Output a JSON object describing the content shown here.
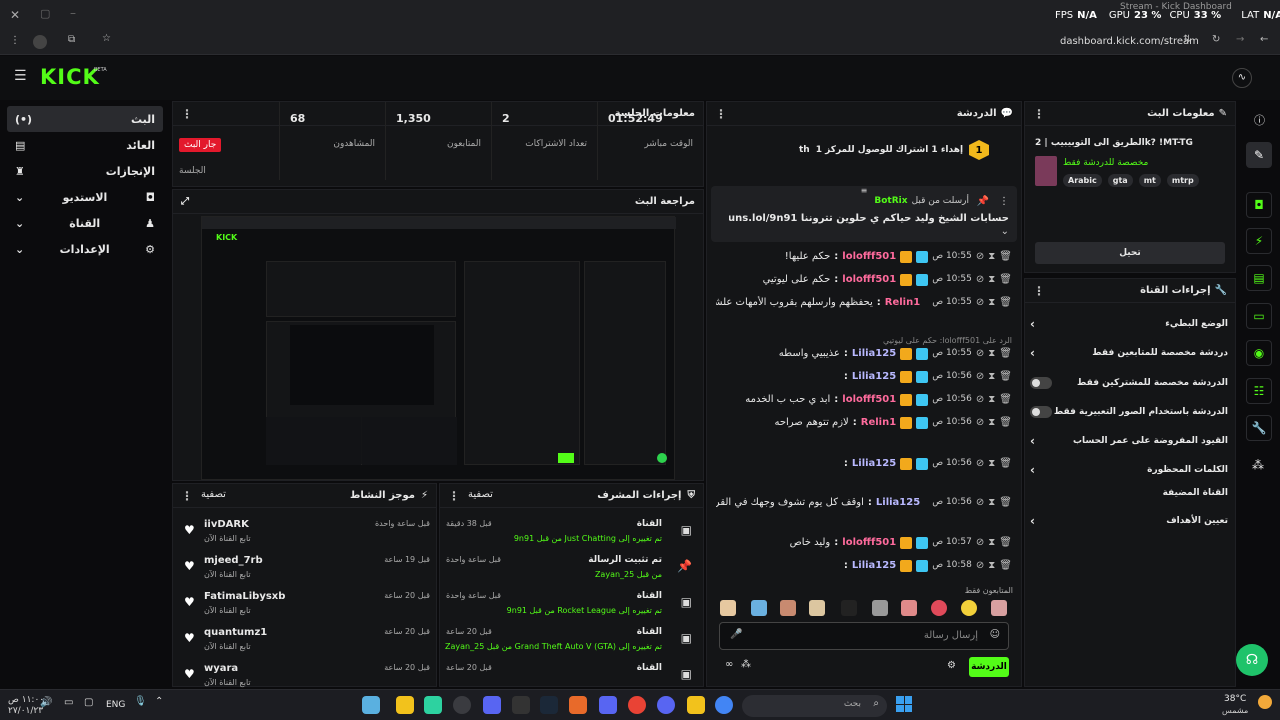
{
  "window": {
    "overlay_fps_label": "FPS",
    "overlay_fps": "N/A",
    "overlay_gpu_label": "GPU",
    "overlay_gpu": "23 %",
    "overlay_cpu_label": "CPU",
    "overlay_cpu": "33 %",
    "overlay_lat_label": "LAT",
    "overlay_lat": "N/A",
    "tab_title": "Stream - Kick Dashboard"
  },
  "browser": {
    "url": "dashboard.kick.com/stream"
  },
  "brand": {
    "logo": "KICK",
    "beta": "BETA",
    "accent": "#53fc18"
  },
  "sidebar": {
    "items": [
      {
        "label": "البث",
        "icon": "broadcast-icon"
      },
      {
        "label": "العائد",
        "icon": "wallet-icon"
      },
      {
        "label": "الإنجازات",
        "icon": "trophy-icon"
      },
      {
        "label": "الاستديو",
        "icon": "studio-icon"
      },
      {
        "label": "القناة",
        "icon": "channel-icon"
      },
      {
        "label": "الإعدادات",
        "icon": "gear-icon"
      }
    ]
  },
  "session": {
    "title": "معلومات الجلسة",
    "live_badge": "جار البث",
    "session_label": "الجلسة",
    "stats": [
      {
        "value": "68",
        "label": "المشاهدون"
      },
      {
        "value": "1,350",
        "label": "المتابعون"
      },
      {
        "value": "2",
        "label": "تعداد الاشتراكات"
      },
      {
        "value": "01:52:49",
        "label": "الوقت مباشر"
      }
    ]
  },
  "preview": {
    "title": "مراجعة البث"
  },
  "activity": {
    "title": "موجز النشاط",
    "filter": "تصفية",
    "items": [
      {
        "user": "iivDARK",
        "sub": "تابع القناة الآن",
        "time": "قبل ساعة واحدة"
      },
      {
        "user": "mjeed_7rb",
        "sub": "تابع القناة الآن",
        "time": "قبل 19 ساعة"
      },
      {
        "user": "FatimaLibysxb",
        "sub": "تابع القناة الآن",
        "time": "قبل 20 ساعة"
      },
      {
        "user": "quantumz1",
        "sub": "تابع القناة الآن",
        "time": "قبل 20 ساعة"
      },
      {
        "user": "wyara",
        "sub": "تابع القناة الآن",
        "time": "قبل 20 ساعة"
      }
    ]
  },
  "modactions": {
    "title": "إجراءات المشرف",
    "filter": "تصفية",
    "items": [
      {
        "head": "القناة",
        "detail": "تم تغييره إلى Just Chatting من قبل 9n91",
        "time": "قبل 38 دقيقة"
      },
      {
        "head": "تم تثبيت الرسالة",
        "detail": "من قبل Zayan_25",
        "time": "قبل ساعة واحدة"
      },
      {
        "head": "القناة",
        "detail": "تم تغييره إلى Rocket League من قبل 9n91",
        "time": "قبل ساعة واحدة"
      },
      {
        "head": "القناة",
        "detail": "تم تغييره إلى Grand Theft Auto V (GTA) من قبل Zayan_25",
        "time": "قبل 20 ساعة"
      },
      {
        "head": "القناة",
        "detail": "",
        "time": "قبل 20 ساعة"
      }
    ]
  },
  "chat": {
    "title": "الدردشة",
    "goal": "إهداء 1 اشتراك للوصول للمركز 1",
    "goal_count": "1",
    "goal_suffix": "th",
    "pinned": {
      "user": "BotRix",
      "note": "أرسلت من قبل",
      "msg": "حسابات الشيخ وليد حياكم ي حلوين تتروننا https://guns.lol/9n91"
    },
    "messages": [
      {
        "time": "10:55 ص",
        "user": "lolofff501",
        "color": "#ff6b9d",
        "text": "حكم عليها!"
      },
      {
        "time": "10:55 ص",
        "user": "lolofff501",
        "color": "#ff6b9d",
        "text": "حكم على ليوتيي"
      },
      {
        "time": "10:55 ص",
        "user": "Relin1",
        "color": "#ff6b9d",
        "text": "يحفظهم وارسلهم بقروب الأمهات علشان يمسكوك ملصقات"
      },
      {
        "time": "10:55 ص",
        "user": "Lilia125",
        "color": "#b9b9ff",
        "text": "عذيبيي واسطه",
        "reply": "الرد على lolofff501: حكم على ليوتيي"
      },
      {
        "time": "10:56 ص",
        "user": "Lilia125",
        "color": "#b9b9ff",
        "text": ""
      },
      {
        "time": "10:56 ص",
        "user": "lolofff501",
        "color": "#ff6b9d",
        "text": "ابد ي حب ب الخدمه"
      },
      {
        "time": "10:56 ص",
        "user": "Relin1",
        "color": "#ff6b9d",
        "text": "لازم تتوهم صراحه"
      },
      {
        "time": "10:56 ص",
        "user": "Lilia125",
        "color": "#b9b9ff",
        "text": ""
      },
      {
        "time": "10:56 ص",
        "user": "Lilia125",
        "color": "#b9b9ff",
        "text": "اوقف كل يوم تشوف وجهك في القروب"
      },
      {
        "time": "10:57 ص",
        "user": "lolofff501",
        "color": "#ff6b9d",
        "text": "وليد خاص"
      },
      {
        "time": "10:58 ص",
        "user": "Lilia125",
        "color": "#b9b9ff",
        "text": ""
      }
    ],
    "followers_only": "المتابعون فقط",
    "input_placeholder": "إرسال رسالة",
    "send": "الدردشة"
  },
  "streaminfo": {
    "title": "معلومات البث",
    "stream_title": "الطريق الى التوبيبيب | 2k? !MT-TG",
    "category": "مخصصة للدردشة فقط",
    "tags": [
      "Arabic",
      "gta",
      "mt",
      "mtrp"
    ],
    "edit": "تحيل"
  },
  "channelactions": {
    "title": "إجراءات القناة",
    "rows": [
      {
        "label": "الوضع البطيء",
        "type": "arrow"
      },
      {
        "label": "دردشة مخصصة للمتابعين فقط",
        "type": "arrow"
      },
      {
        "label": "الدردشة مخصصة للمشتركين فقط",
        "type": "toggle"
      },
      {
        "label": "الدردشة باستخدام الصور التعبيرية فقط",
        "type": "toggle"
      },
      {
        "label": "القيود المفروضة على عمر الحساب",
        "type": "arrow"
      },
      {
        "label": "الكلمات المحظورة",
        "type": "arrow"
      }
    ],
    "section": "القناة المضيفة",
    "target": "تعيين الأهداف"
  },
  "taskbar": {
    "time": "١١:٠٠ ص",
    "date": "٢٧/٠١/٢٣",
    "lang": "ENG",
    "search": "بحث",
    "weather_temp": "38°C",
    "weather_desc": "مشمس"
  }
}
